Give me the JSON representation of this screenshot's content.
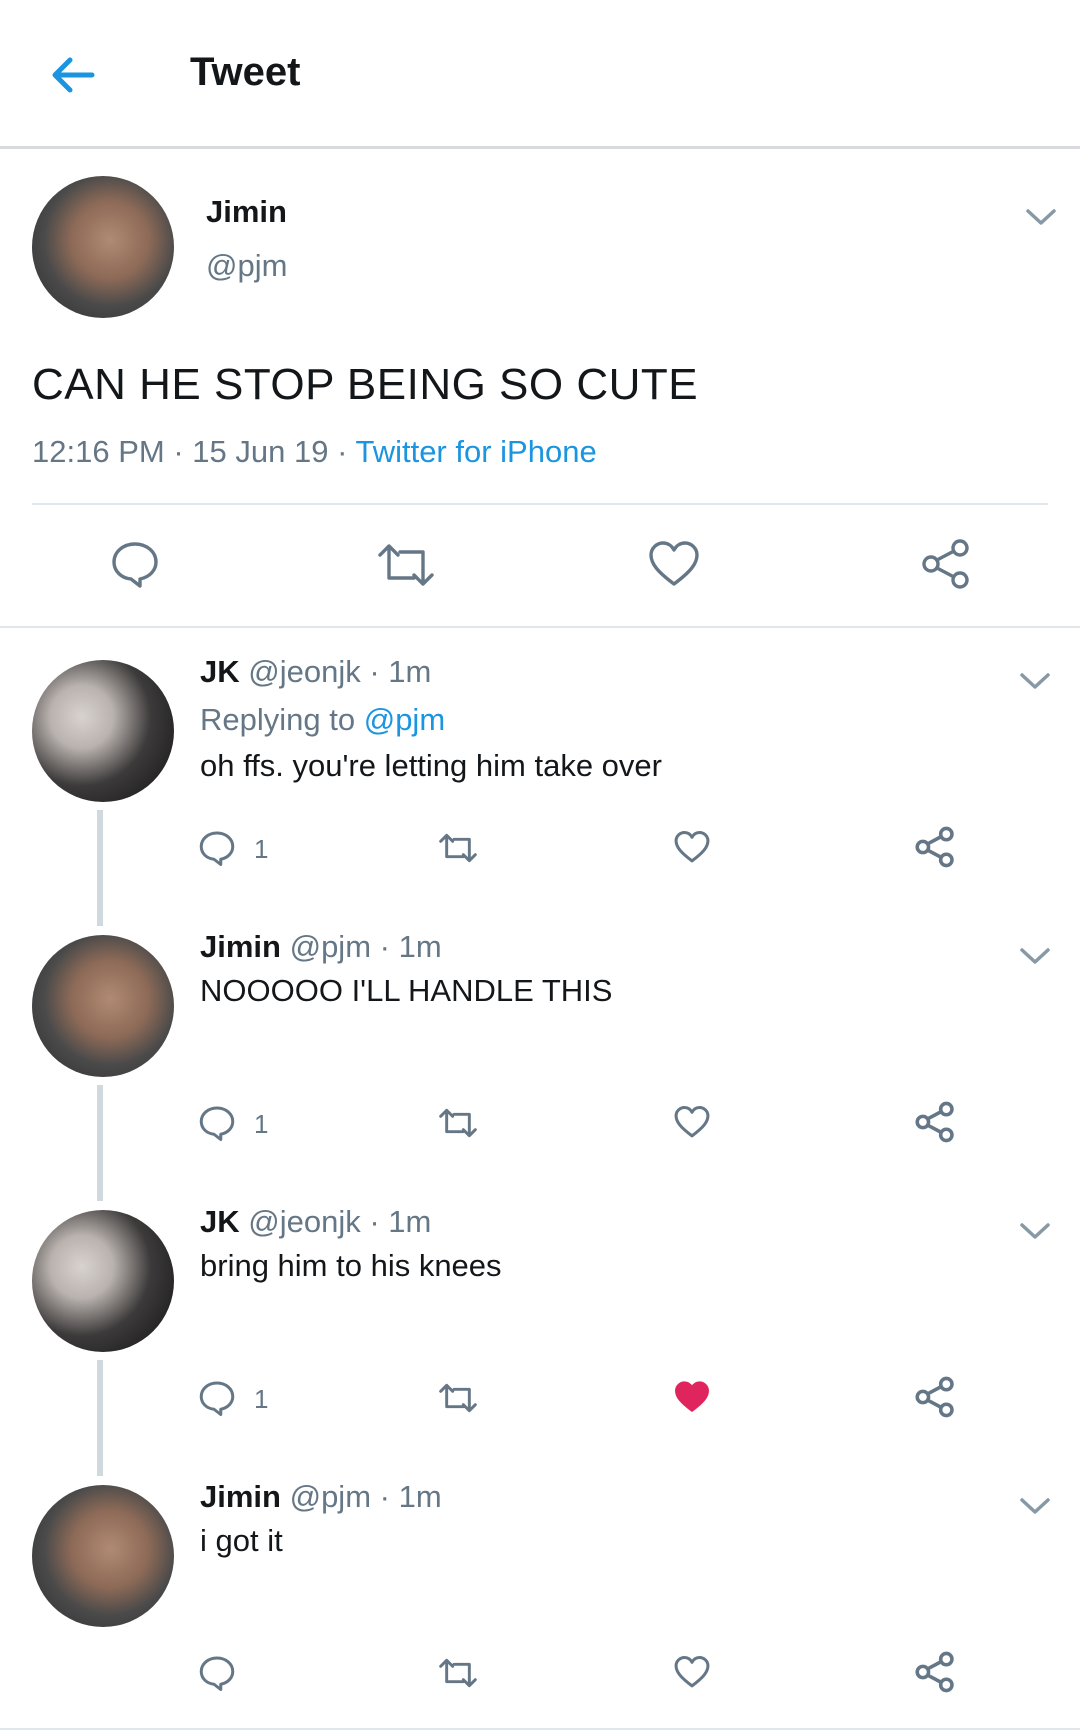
{
  "header": {
    "title": "Tweet"
  },
  "main_tweet": {
    "name": "Jimin",
    "handle": "@pjm",
    "text": "CAN HE STOP BEING SO CUTE",
    "time": "12:16 PM",
    "date": "15 Jun 19",
    "sep": "·",
    "source": "Twitter for iPhone"
  },
  "replies": [
    {
      "name": "JK",
      "handle": "@jeonjk",
      "meta": "· 1m",
      "replying_prefix": "Replying to",
      "replying_handle": "@pjm",
      "text": "oh ffs. you're letting him take over",
      "reply_count": "1",
      "liked": false
    },
    {
      "name": "Jimin",
      "handle": "@pjm",
      "meta": "· 1m",
      "text": "NOOOOO I'LL HANDLE THIS",
      "reply_count": "1",
      "liked": false
    },
    {
      "name": "JK",
      "handle": "@jeonjk",
      "meta": "· 1m",
      "text": "bring him to his knees",
      "reply_count": "1",
      "liked": true
    },
    {
      "name": "Jimin",
      "handle": "@pjm",
      "meta": "· 1m",
      "text": "i got it",
      "reply_count": "",
      "liked": false
    }
  ],
  "colors": {
    "accent": "#1b95e0",
    "like": "#e0245e",
    "muted": "#657786",
    "icon": "#657786"
  },
  "icons": [
    "back-arrow-icon",
    "chevron-down-icon",
    "reply-icon",
    "retweet-icon",
    "heart-icon",
    "share-icon"
  ]
}
